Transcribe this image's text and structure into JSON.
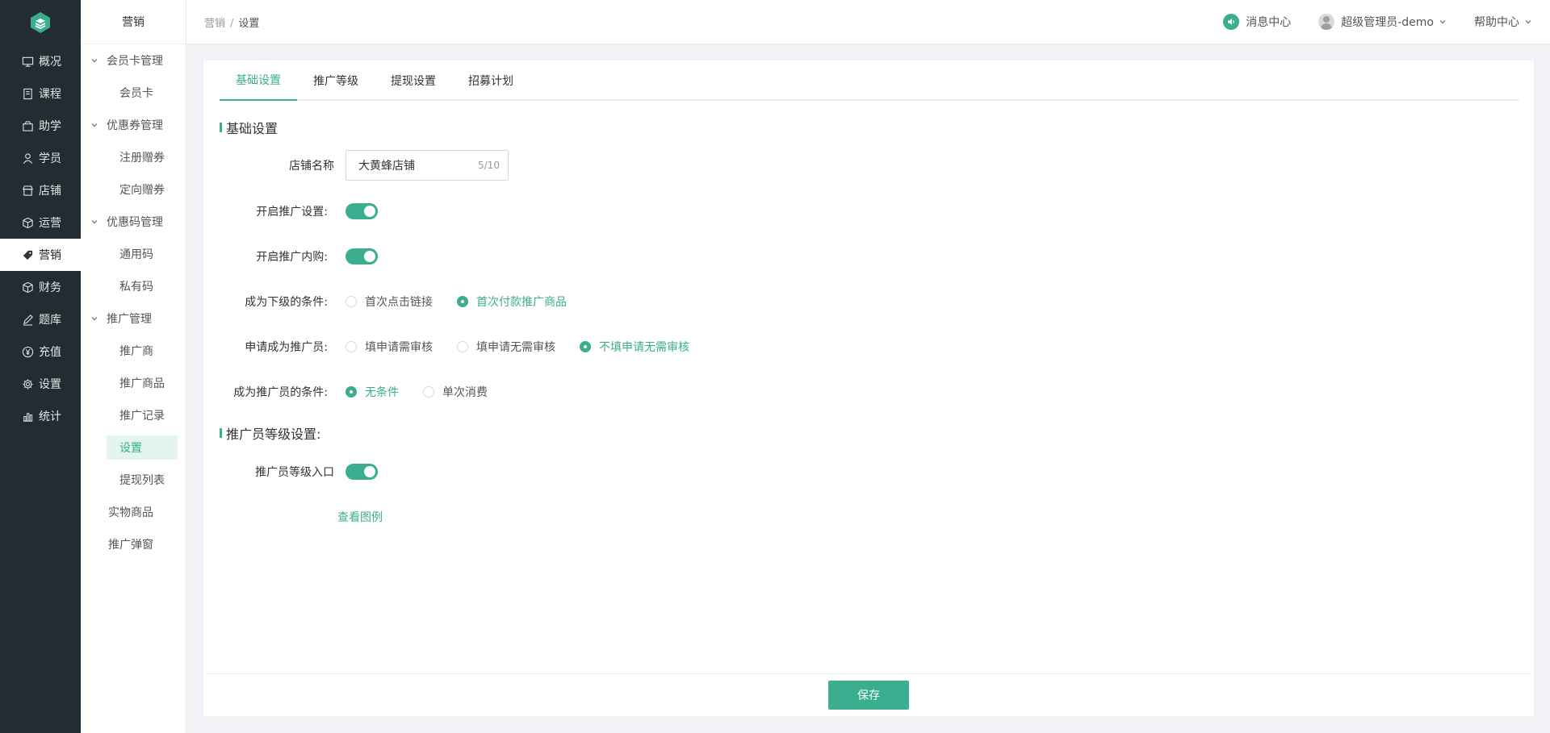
{
  "colors": {
    "accent": "#3aae8f",
    "sidebar_bg": "#212c33"
  },
  "nav1": {
    "logo_icon": "logo-icon",
    "items": [
      {
        "label": "概况",
        "icon": "monitor-icon"
      },
      {
        "label": "课程",
        "icon": "book-icon"
      },
      {
        "label": "助学",
        "icon": "box-icon"
      },
      {
        "label": "学员",
        "icon": "user-icon"
      },
      {
        "label": "店铺",
        "icon": "shop-icon"
      },
      {
        "label": "运营",
        "icon": "cube-icon"
      },
      {
        "label": "营销",
        "icon": "tag-icon"
      },
      {
        "label": "财务",
        "icon": "cube-icon"
      },
      {
        "label": "题库",
        "icon": "pen-icon"
      },
      {
        "label": "充值",
        "icon": "yen-icon"
      },
      {
        "label": "设置",
        "icon": "gear-icon"
      },
      {
        "label": "统计",
        "icon": "bar-chart-icon"
      }
    ],
    "active_index": 6
  },
  "nav2": {
    "title": "营销",
    "groups": [
      {
        "label": "会员卡管理",
        "items": [
          "会员卡"
        ]
      },
      {
        "label": "优惠券管理",
        "items": [
          "注册赠券",
          "定向赠券"
        ]
      },
      {
        "label": "优惠码管理",
        "items": [
          "通用码",
          "私有码"
        ]
      },
      {
        "label": "推广管理",
        "items": [
          "推广商",
          "推广商品",
          "推广记录",
          "设置",
          "提现列表"
        ]
      }
    ],
    "plain": [
      "实物商品",
      "推广弹窗"
    ],
    "active": "设置"
  },
  "header": {
    "breadcrumb": [
      "营销",
      "设置"
    ],
    "breadcrumb_sep": "/",
    "messages": "消息中心",
    "user": "超级管理员-demo",
    "help": "帮助中心"
  },
  "tabs": [
    "基础设置",
    "推广等级",
    "提现设置",
    "招募计划"
  ],
  "active_tab": 0,
  "basic": {
    "title": "基础设置",
    "shop_name": {
      "label": "店铺名称",
      "value": "大黄蜂店铺",
      "count": "5/10"
    },
    "promo_setting": {
      "label": "开启推广设置:",
      "on": true
    },
    "promo_inner_buy": {
      "label": "开启推广内购:",
      "on": true
    },
    "subordinate_condition": {
      "label": "成为下级的条件:",
      "options": [
        "首次点击链接",
        "首次付款推广商品"
      ],
      "selected": 1
    },
    "apply_promoter": {
      "label": "申请成为推广员:",
      "options": [
        "填申请需审核",
        "填申请无需审核",
        "不填申请无需审核"
      ],
      "selected": 2
    },
    "promoter_condition": {
      "label": "成为推广员的条件:",
      "options": [
        "无条件",
        "单次消费"
      ],
      "selected": 0
    }
  },
  "level": {
    "title": "推广员等级设置:",
    "entry": {
      "label": "推广员等级入口",
      "on": true
    },
    "view_example": "查看图例"
  },
  "footer": {
    "save": "保存"
  }
}
